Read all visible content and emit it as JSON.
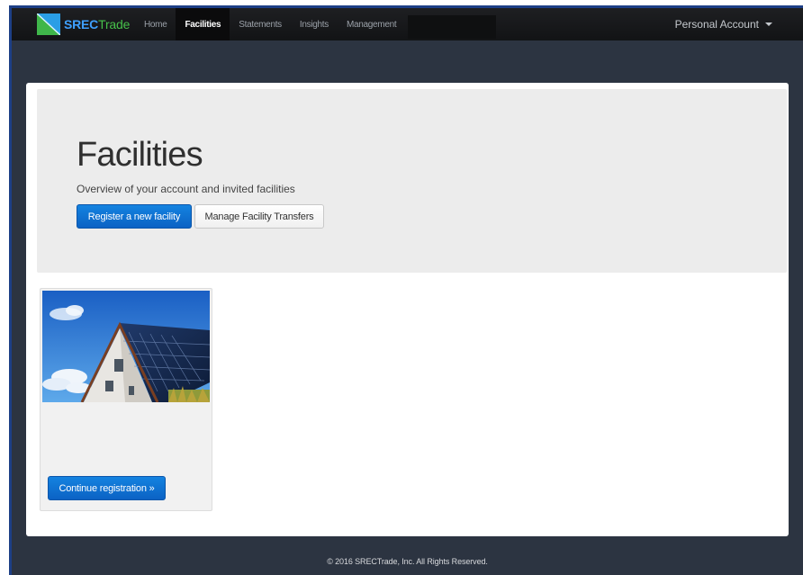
{
  "brand": {
    "name_part1": "SREC",
    "name_part2": "Trade",
    "logo_icon": "srectrade-logo-icon"
  },
  "nav": {
    "items": [
      {
        "label": "Home",
        "active": false
      },
      {
        "label": "Facilities",
        "active": true
      },
      {
        "label": "Statements",
        "active": false
      },
      {
        "label": "Insights",
        "active": false
      },
      {
        "label": "Management",
        "active": false
      }
    ],
    "account_label": "Personal Account",
    "account_icon": "caret-down-icon"
  },
  "hero": {
    "title": "Facilities",
    "subtitle": "Overview of your account and invited facilities",
    "primary_button": "Register a new facility",
    "secondary_button": "Manage Facility Transfers"
  },
  "facility_card": {
    "image": "solar-house-image",
    "button": "Continue registration »"
  },
  "footer": {
    "text": "© 2016 SRECTrade, Inc. All Rights Reserved."
  },
  "colors": {
    "frame_bg": "#2c3441",
    "navbar_bg": "#121315",
    "primary": "#0b62c4",
    "jumbotron_bg": "#ececec",
    "brand_blue": "#3fa0ff",
    "brand_green": "#46c04a"
  }
}
